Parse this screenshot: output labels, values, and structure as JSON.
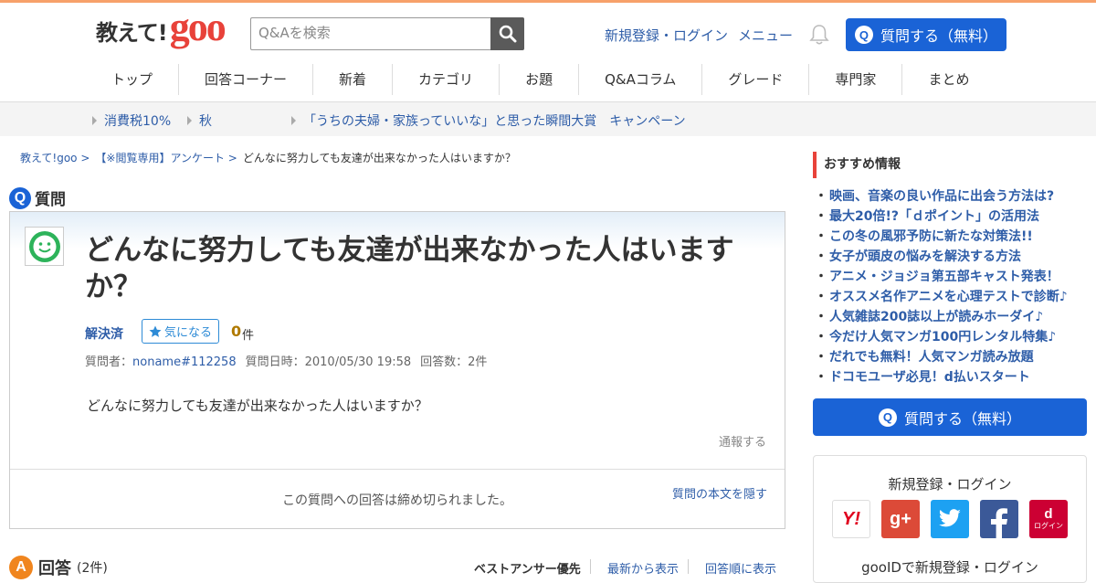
{
  "header": {
    "logo_text": "教えて!",
    "logo_brand": "goo",
    "search_placeholder": "Q&Aを検索",
    "register_login": "新規登録・ログイン",
    "menu": "メニュー",
    "ask_button": "質問する（無料）",
    "ask_icon_letter": "Q"
  },
  "nav": [
    "トップ",
    "回答コーナー",
    "新着",
    "カテゴリ",
    "お題",
    "Q&Aコラム",
    "グレード",
    "専門家",
    "まとめ"
  ],
  "sub_bar": [
    "消費税10%",
    "秋",
    "「うちの夫婦・家族っていいな」と思った瞬間大賞　キャンペーン"
  ],
  "breadcrumb": [
    "教えて!goo >",
    "【※閲覧専用】アンケート >",
    "どんなに努力しても友達が出来なかった人はいますか？"
  ],
  "question": {
    "heading": "質問",
    "badge": "Q",
    "title": "どんなに努力しても友達が出来なかった人はいますか？",
    "status": "解決済",
    "kininaru_label": "気になる",
    "kininaru_count": "0",
    "kininaru_unit": "件",
    "asker_label": "質問者：",
    "asker": "noname#112258",
    "date": "質問日時：2010/05/30 19:58",
    "answer_count": "回答数：2件",
    "body": "どんなに努力しても友達が出来なかった人はいますか？",
    "report": "通報する",
    "closed_notice": "この質問への回答は締め切られました。",
    "hide_body": "質問の本文を隠す"
  },
  "answers": {
    "badge": "A",
    "heading": "回答",
    "count": "(2件)",
    "sort_best": "ベストアンサー優先",
    "sort_newest": "最新から表示",
    "sort_order": "回答順に表示"
  },
  "sidebar": {
    "title": "おすすめ情報",
    "items": [
      "映画、音楽の良い作品に出会う方法は?",
      "最大20倍!?「ｄポイント」の活用法",
      "この冬の風邪予防に新たな対策法!!",
      "女子が頭皮の悩みを解決する方法",
      "アニメ・ジョジョ第五部キャスト発表！",
      "オススメ名作アニメを心理テストで診断♪",
      "人気雑誌200誌以上が読みホーダイ♪",
      "今だけ人気マンガ100円レンタル特集♪",
      "だれでも無料！人気マンガ読み放題",
      "ドコモユーザ必見！d払いスタート"
    ],
    "ask_button": "質問する（無料）",
    "login_title": "新規登録・ログイン",
    "gooid_text": "gooIDで新規登録・ログイン",
    "social_yahoo": "Y!",
    "social_google": "g+",
    "social_d": "d",
    "social_d_sub": "ログイン"
  },
  "colors": {
    "accent_blue": "#1a63d6",
    "brand_red": "#e8423a",
    "link_blue": "#2e5da8"
  }
}
